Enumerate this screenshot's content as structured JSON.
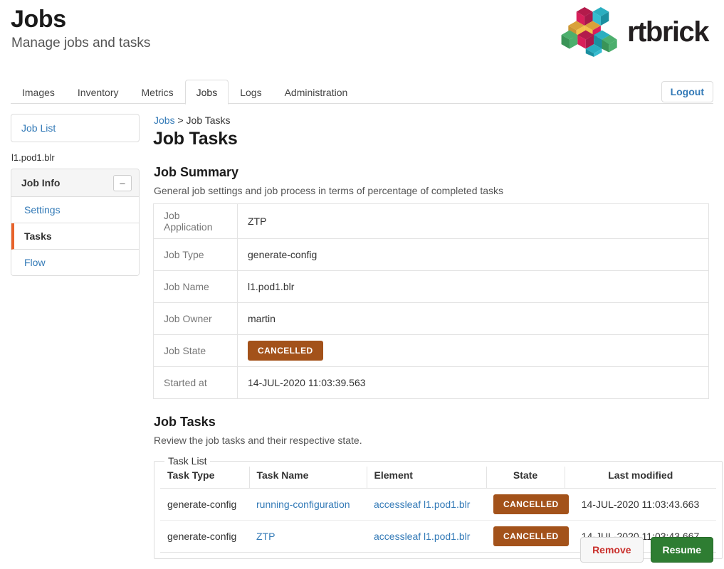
{
  "header": {
    "title": "Jobs",
    "subtitle": "Manage jobs and tasks",
    "brand_name": "rtbrick",
    "brand_colors": {
      "magenta": "#d81f5a",
      "crimson": "#b31b4b",
      "cyan": "#2aaec0",
      "teal": "#1b8fa0",
      "green": "#4caf6d",
      "darkgreen": "#3a9457",
      "yellow": "#f3c14a",
      "gold": "#d9a13a",
      "text": "#231f20"
    }
  },
  "nav": {
    "tabs": [
      {
        "label": "Images",
        "active": false
      },
      {
        "label": "Inventory",
        "active": false
      },
      {
        "label": "Metrics",
        "active": false
      },
      {
        "label": "Jobs",
        "active": true
      },
      {
        "label": "Logs",
        "active": false
      },
      {
        "label": "Administration",
        "active": false
      }
    ],
    "logout_label": "Logout",
    "link_color": "#337ab7"
  },
  "sidebar": {
    "job_list_label": "Job List",
    "caption": "l1.pod1.blr",
    "panel_title": "Job Info",
    "collapse_icon": "–",
    "items": [
      {
        "label": "Settings",
        "active": false
      },
      {
        "label": "Tasks",
        "active": true
      },
      {
        "label": "Flow",
        "active": false
      }
    ],
    "active_accent_color": "#e8622a"
  },
  "breadcrumb": {
    "root_label": "Jobs",
    "separator": ">",
    "current_label": "Job Tasks"
  },
  "main": {
    "page_heading": "Job Tasks",
    "summary": {
      "heading": "Job Summary",
      "description": "General job settings and job process in terms of percentage of completed tasks",
      "rows": [
        {
          "key": "Job Application",
          "value": "ZTP",
          "type": "text"
        },
        {
          "key": "Job Type",
          "value": "generate-config",
          "type": "text"
        },
        {
          "key": "Job Name",
          "value": "l1.pod1.blr",
          "type": "text"
        },
        {
          "key": "Job Owner",
          "value": "martin",
          "type": "text"
        },
        {
          "key": "Job State",
          "value": "CANCELLED",
          "type": "badge"
        },
        {
          "key": "Started at",
          "value": "14-JUL-2020 11:03:39.563",
          "type": "text"
        }
      ]
    },
    "tasks": {
      "heading": "Job Tasks",
      "description": "Review the job tasks and their respective state.",
      "legend": "Task List",
      "columns": [
        "Task Type",
        "Task Name",
        "Element",
        "State",
        "Last modified"
      ],
      "rows": [
        {
          "task_type": "generate-config",
          "task_name": "running-configuration",
          "element": "accessleaf l1.pod1.blr",
          "state": "CANCELLED",
          "last_modified": "14-JUL-2020 11:03:43.663"
        },
        {
          "task_type": "generate-config",
          "task_name": "ZTP",
          "element": "accessleaf l1.pod1.blr",
          "state": "CANCELLED",
          "last_modified": "14-JUL-2020 11:03:43.667"
        }
      ]
    }
  },
  "actions": {
    "remove_label": "Remove",
    "resume_label": "Resume",
    "remove_color": "#c9302c",
    "resume_color": "#2e7d32"
  },
  "colors": {
    "state_badge_bg": "#a3521a",
    "link": "#337ab7"
  }
}
